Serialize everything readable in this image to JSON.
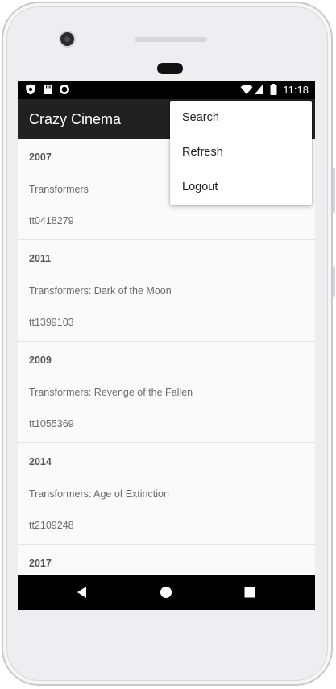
{
  "status_bar": {
    "icons": [
      "shield-icon",
      "sd-card-icon",
      "record-icon",
      "wifi-icon",
      "cell-signal-icon",
      "battery-icon"
    ],
    "time": "11:18"
  },
  "toolbar": {
    "title": "Crazy Cinema"
  },
  "overflow_menu": {
    "items": [
      {
        "label": "Search"
      },
      {
        "label": "Refresh"
      },
      {
        "label": "Logout"
      }
    ]
  },
  "movies": [
    {
      "year": "2007",
      "title": "Transformers",
      "imdb_id": "tt0418279"
    },
    {
      "year": "2011",
      "title": "Transformers: Dark of the Moon",
      "imdb_id": "tt1399103"
    },
    {
      "year": "2009",
      "title": "Transformers: Revenge of the Fallen",
      "imdb_id": "tt1055369"
    },
    {
      "year": "2014",
      "title": "Transformers: Age of Extinction",
      "imdb_id": "tt2109248"
    },
    {
      "year": "2017",
      "title": "",
      "imdb_id": ""
    }
  ],
  "nav_bar": {
    "icons": [
      "back-icon",
      "home-icon",
      "recents-icon"
    ]
  },
  "colors": {
    "toolbar": "#212121",
    "status_bar": "#000000",
    "list_background": "#fafafa",
    "menu_background": "#ffffff"
  }
}
